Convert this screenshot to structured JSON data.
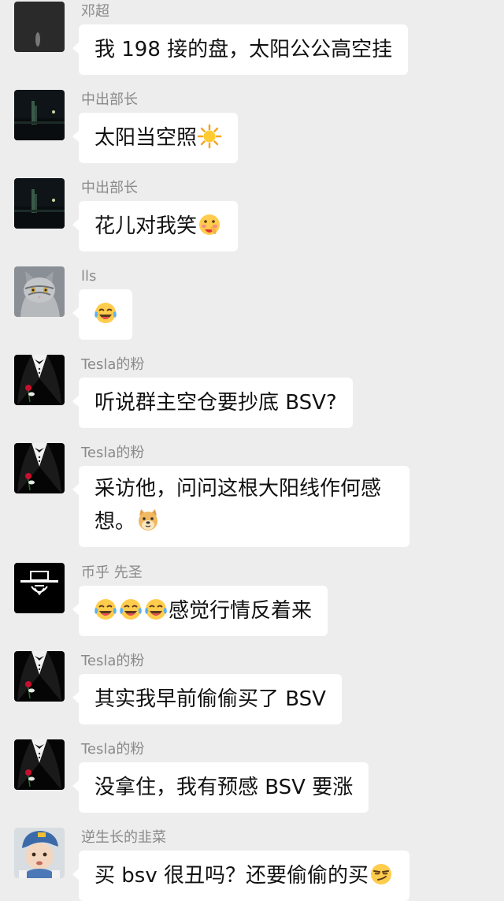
{
  "messages": [
    {
      "sender": "邓超",
      "text": "我 198 接的盘，太阳公公高空挂",
      "avatar": "dark-gray-avatar"
    },
    {
      "sender": "中出部长",
      "text": "太阳当空照",
      "emoji": [
        "sun-emoji"
      ],
      "avatar": "night-city-avatar"
    },
    {
      "sender": "中出部长",
      "text": "花儿对我笑",
      "emoji": [
        "face-hand-emoji"
      ],
      "avatar": "night-city-avatar"
    },
    {
      "sender": "lls",
      "text": "",
      "emoji": [
        "tears-of-joy-emoji"
      ],
      "avatar": "cat-avatar"
    },
    {
      "sender": "Tesla的粉",
      "text": "听说群主空仓要抄底 BSV?",
      "avatar": "tuxedo-rose-avatar"
    },
    {
      "sender": "Tesla的粉",
      "text_line1": "采访他，问问这根大阳线作何感",
      "text_line2": "想。",
      "emoji": [
        "doge-emoji"
      ],
      "avatar": "tuxedo-rose-avatar"
    },
    {
      "sender": "币乎 先圣",
      "text": "感觉行情反着来",
      "emoji": [
        "tears-of-joy-emoji",
        "tears-of-joy-emoji",
        "tears-of-joy-emoji"
      ],
      "avatar": "hat-man-avatar"
    },
    {
      "sender": "Tesla的粉",
      "text": "其实我早前偷偷买了 BSV",
      "avatar": "tuxedo-rose-avatar"
    },
    {
      "sender": "Tesla的粉",
      "text": "没拿住，我有预感 BSV 要涨",
      "avatar": "tuxedo-rose-avatar"
    },
    {
      "sender": "逆生长的韭菜",
      "text": "买 bsv 很丑吗？还要偷偷的买",
      "emoji": [
        "smirk-emoji"
      ],
      "avatar": "child-avatar"
    }
  ]
}
